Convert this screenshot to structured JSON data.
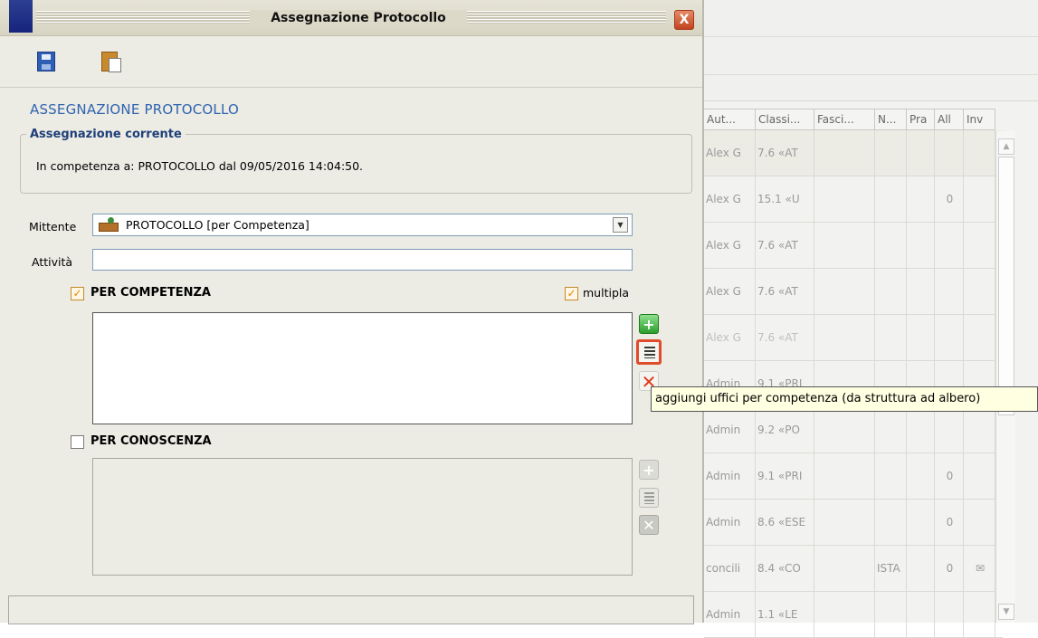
{
  "dialog": {
    "title": "Assegnazione Protocollo",
    "close_label": "X",
    "heading": "ASSEGNAZIONE PROTOCOLLO",
    "current_group": {
      "legend": "Assegnazione corrente",
      "text": "In competenza a: PROTOCOLLO  dal  09/05/2016 14:04:50."
    },
    "mittente": {
      "label": "Mittente",
      "value": "PROTOCOLLO [per Competenza]",
      "icon": "office-person-icon"
    },
    "attivita": {
      "label": "Attività",
      "value": ""
    },
    "per_competenza": {
      "label": "PER COMPETENZA",
      "checked": true,
      "check_mark": "✓"
    },
    "multipla": {
      "label": "multipla",
      "checked": true,
      "check_mark": "✓"
    },
    "per_conoscenza": {
      "label": "PER CONOSCENZA",
      "checked": false,
      "check_mark": ""
    },
    "tooltip": "aggiungi uffici per competenza (da struttura ad albero)",
    "accent_color": "#2f64b0",
    "highlight_color": "#e04b2a"
  },
  "grid": {
    "columns": [
      "Aut...",
      "Classi...",
      "Fasci...",
      "N...",
      "Pra",
      "All",
      "Inv"
    ],
    "rows": [
      {
        "author": "Alex G",
        "class": "7.6 «AT",
        "num": "",
        "attach": "",
        "inv": "",
        "selected": true,
        "dim": false
      },
      {
        "author": "Alex G",
        "class": "15.1 «U",
        "num": "",
        "attach": "0",
        "inv": "",
        "selected": false,
        "dim": false
      },
      {
        "author": "Alex G",
        "class": "7.6 «AT",
        "num": "",
        "attach": "",
        "inv": "",
        "selected": false,
        "dim": false
      },
      {
        "author": "Alex G",
        "class": "7.6 «AT",
        "num": "",
        "attach": "",
        "inv": "",
        "selected": false,
        "dim": false
      },
      {
        "author": "Alex G",
        "class": "7.6 «AT",
        "num": "",
        "attach": "",
        "inv": "",
        "selected": false,
        "dim": true
      },
      {
        "author": "Admin",
        "class": "9.1 «PRI",
        "num": "",
        "attach": "",
        "inv": "",
        "selected": false,
        "dim": false
      },
      {
        "author": "Admin",
        "class": "9.2 «PO",
        "num": "",
        "attach": "",
        "inv": "",
        "selected": false,
        "dim": false
      },
      {
        "author": "Admin",
        "class": "9.1 «PRI",
        "num": "",
        "attach": "0",
        "inv": "",
        "selected": false,
        "dim": false
      },
      {
        "author": "Admin",
        "class": "8.6 «ESE",
        "num": "",
        "attach": "0",
        "inv": "",
        "selected": false,
        "dim": false
      },
      {
        "author": "concili",
        "class": "8.4 «CO",
        "num": "ISTA",
        "attach": "0",
        "inv": "✉",
        "selected": false,
        "dim": false
      },
      {
        "author": "Admin",
        "class": "1.1 «LE",
        "num": "",
        "attach": "",
        "inv": "",
        "selected": false,
        "dim": false
      }
    ]
  }
}
